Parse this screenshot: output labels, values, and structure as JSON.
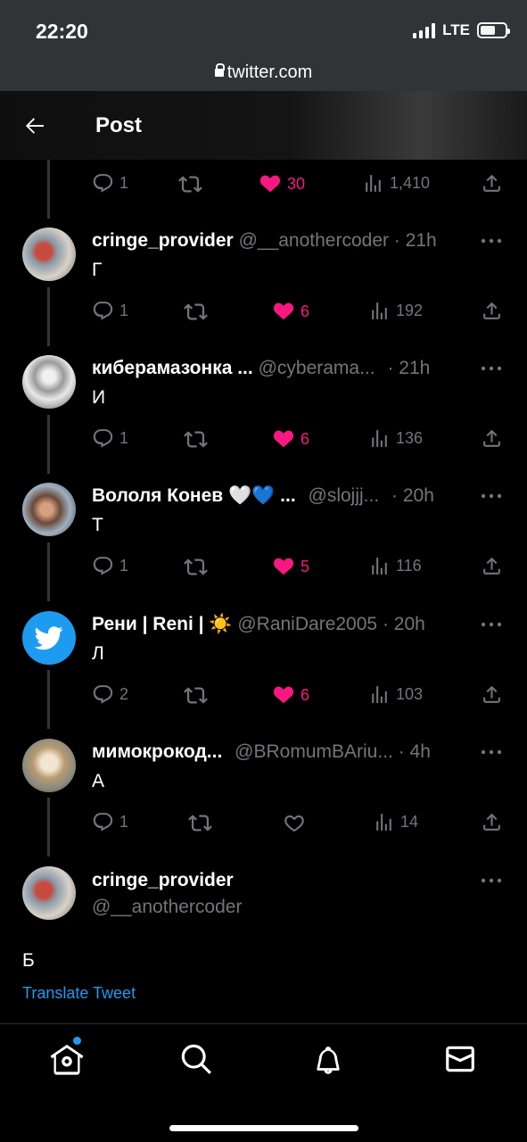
{
  "status_bar": {
    "time": "22:20",
    "network": "LTE"
  },
  "browser": {
    "url": "twitter.com"
  },
  "header": {
    "title": "Post"
  },
  "parent_actions": {
    "replies": "1",
    "likes": "30",
    "views": "1,410"
  },
  "replies": [
    {
      "name": "cringe_provider",
      "handle": "@__anothercoder",
      "time": "· 21h",
      "text": "Г",
      "reply_count": "1",
      "likes": "6",
      "views": "192",
      "liked": true
    },
    {
      "name": "киберамазонка ...",
      "handle": "@cyberama...",
      "time": "· 21h",
      "text": "И",
      "reply_count": "1",
      "likes": "6",
      "views": "136",
      "liked": true
    },
    {
      "name": "Вололя Конев 🤍💙 ...",
      "handle": "@slojjj...",
      "time": "· 20h",
      "text": "Т",
      "reply_count": "1",
      "likes": "5",
      "views": "116",
      "liked": true
    },
    {
      "name": "Рени | Reni | ☀️",
      "handle": "@RaniDare2005",
      "time": "· 20h",
      "text": "Л",
      "reply_count": "2",
      "likes": "6",
      "views": "103",
      "liked": true
    },
    {
      "name": "мимокрокод...",
      "handle": "@BRomumBAriu...",
      "time": "· 4h",
      "text": "А",
      "reply_count": "1",
      "likes": "",
      "views": "14",
      "liked": false
    }
  ],
  "focused_tweet": {
    "name": "cringe_provider",
    "handle": "@__anothercoder",
    "text": "Б",
    "translate_label": "Translate Tweet"
  },
  "colors": {
    "like": "#f91880",
    "accent": "#1d9bf0",
    "muted": "#71767b",
    "background": "#000000"
  },
  "icons": [
    "back-arrow-icon",
    "reply-icon",
    "retweet-icon",
    "heart-icon",
    "views-icon",
    "share-icon",
    "more-icon",
    "home-icon",
    "search-icon",
    "bell-icon",
    "mail-icon",
    "twitter-bird-icon"
  ]
}
